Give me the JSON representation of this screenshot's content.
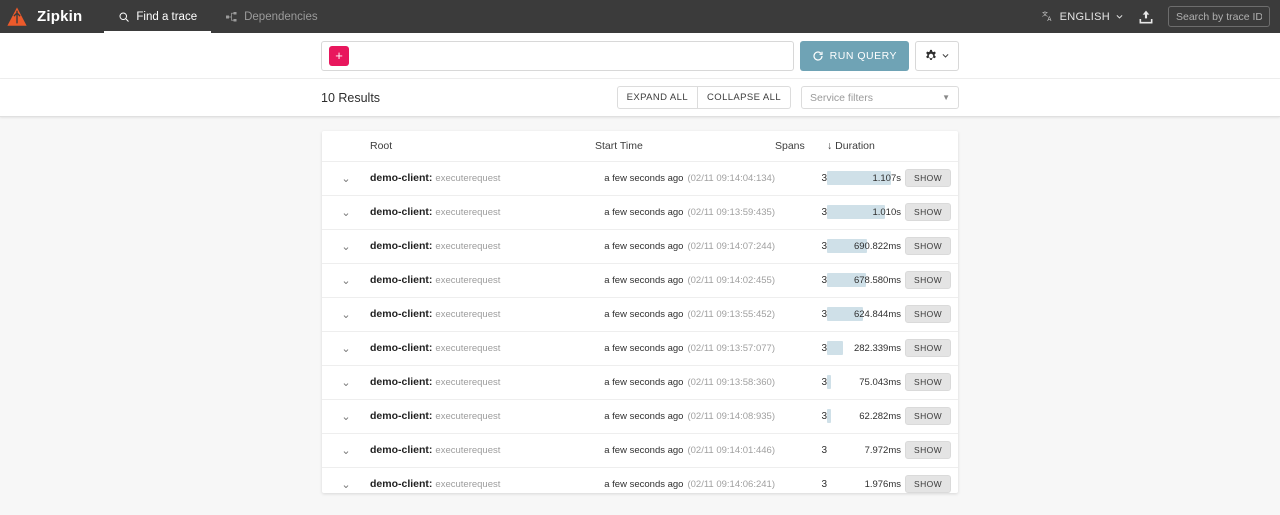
{
  "navbar": {
    "logo_icon": "zipkin-logo-icon",
    "brand": "Zipkin",
    "tabs": [
      {
        "label": "Find a trace",
        "icon": "search-icon",
        "active": true
      },
      {
        "label": "Dependencies",
        "icon": "dependencies-icon",
        "active": false
      }
    ],
    "language": {
      "label": "ENGLISH",
      "icon": "translate-icon",
      "caret": "chevron-down-icon"
    },
    "upload_icon": "upload-icon",
    "trace_search_placeholder": "Search by trace ID",
    "trace_search_value": "",
    "background": "#3b3b3b"
  },
  "querybar": {
    "add_criterion_label": "+",
    "add_criterion_color": "#e8175d",
    "criteria_value": "",
    "run_query_label": "RUN QUERY",
    "run_query_icon": "refresh-icon",
    "run_query_color": "#6fa3b5",
    "settings_icon": "gear-icon",
    "settings_caret": "chevron-down-icon"
  },
  "results_toolbar": {
    "count_label": "10 Results",
    "expand_all_label": "EXPAND ALL",
    "collapse_all_label": "COLLAPSE ALL",
    "service_filters_placeholder": "Service filters",
    "service_filters_caret": "chevron-down-icon"
  },
  "table": {
    "columns": {
      "root": "Root",
      "start_time": "Start Time",
      "spans": "Spans",
      "duration": "Duration",
      "sort_icon": "arrow-down-icon"
    },
    "show_label": "SHOW",
    "row_chevron": "chevron-down-icon",
    "bar_color": "#cfe0e8",
    "max_duration_ms": 1107,
    "rows": [
      {
        "service": "demo-client:",
        "span": "executerequest",
        "relative_time": "a few seconds ago",
        "absolute_time": "(02/11 09:14:04:134)",
        "spans": "3",
        "duration": "1.107s",
        "duration_ms": 1107
      },
      {
        "service": "demo-client:",
        "span": "executerequest",
        "relative_time": "a few seconds ago",
        "absolute_time": "(02/11 09:13:59:435)",
        "spans": "3",
        "duration": "1.010s",
        "duration_ms": 1010
      },
      {
        "service": "demo-client:",
        "span": "executerequest",
        "relative_time": "a few seconds ago",
        "absolute_time": "(02/11 09:14:07:244)",
        "spans": "3",
        "duration": "690.822ms",
        "duration_ms": 690.822
      },
      {
        "service": "demo-client:",
        "span": "executerequest",
        "relative_time": "a few seconds ago",
        "absolute_time": "(02/11 09:14:02:455)",
        "spans": "3",
        "duration": "678.580ms",
        "duration_ms": 678.58
      },
      {
        "service": "demo-client:",
        "span": "executerequest",
        "relative_time": "a few seconds ago",
        "absolute_time": "(02/11 09:13:55:452)",
        "spans": "3",
        "duration": "624.844ms",
        "duration_ms": 624.844
      },
      {
        "service": "demo-client:",
        "span": "executerequest",
        "relative_time": "a few seconds ago",
        "absolute_time": "(02/11 09:13:57:077)",
        "spans": "3",
        "duration": "282.339ms",
        "duration_ms": 282.339
      },
      {
        "service": "demo-client:",
        "span": "executerequest",
        "relative_time": "a few seconds ago",
        "absolute_time": "(02/11 09:13:58:360)",
        "spans": "3",
        "duration": "75.043ms",
        "duration_ms": 75.043
      },
      {
        "service": "demo-client:",
        "span": "executerequest",
        "relative_time": "a few seconds ago",
        "absolute_time": "(02/11 09:14:08:935)",
        "spans": "3",
        "duration": "62.282ms",
        "duration_ms": 62.282
      },
      {
        "service": "demo-client:",
        "span": "executerequest",
        "relative_time": "a few seconds ago",
        "absolute_time": "(02/11 09:14:01:446)",
        "spans": "3",
        "duration": "7.972ms",
        "duration_ms": 7.972
      },
      {
        "service": "demo-client:",
        "span": "executerequest",
        "relative_time": "a few seconds ago",
        "absolute_time": "(02/11 09:14:06:241)",
        "spans": "3",
        "duration": "1.976ms",
        "duration_ms": 1.976
      }
    ]
  }
}
